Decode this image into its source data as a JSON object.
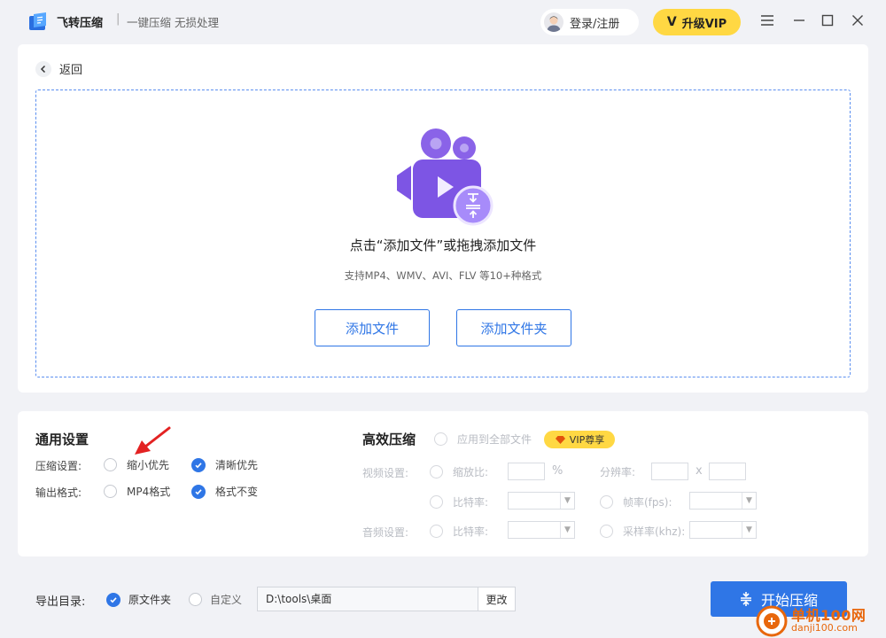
{
  "app": {
    "title": "飞转压缩",
    "separator": "|",
    "subtitle": "一键压缩 无损处理",
    "login_label": "登录/注册",
    "vip_mark": "V",
    "vip_label": "升级VIP"
  },
  "window_icons": [
    "menu-icon",
    "minimize-icon",
    "maximize-icon",
    "close-icon"
  ],
  "upload": {
    "back_label": "返回",
    "drop_title": "点击“添加文件”或拖拽添加文件",
    "drop_hint": "支持MP4、WMV、AVI、FLV 等10+种格式",
    "add_file_label": "添加文件",
    "add_folder_label": "添加文件夹"
  },
  "general": {
    "title": "通用设置",
    "compress_label": "压缩设置:",
    "compress_options": [
      {
        "label": "缩小优先",
        "checked": false
      },
      {
        "label": "清晰优先",
        "checked": true
      }
    ],
    "format_label": "输出格式:",
    "format_options": [
      {
        "label": "MP4格式",
        "checked": false
      },
      {
        "label": "格式不变",
        "checked": true
      }
    ]
  },
  "efficient": {
    "title": "高效压缩",
    "apply_all_label": "应用到全部文件",
    "vip_badge": "VIP尊享",
    "video_label": "视频设置:",
    "scale_label": "缩放比:",
    "percent_unit": "%",
    "resolution_label": "分辨率:",
    "resolution_x": "x",
    "bitrate_label": "比特率:",
    "fps_label": "帧率(fps):",
    "audio_label": "音频设置:",
    "audio_bitrate_label": "比特率:",
    "sample_rate_label": "采样率(khz):"
  },
  "output": {
    "label": "导出目录:",
    "original_label": "原文件夹",
    "original_checked": true,
    "custom_label": "自定义",
    "custom_checked": false,
    "path_value": "D:\\tools\\桌面",
    "change_label": "更改",
    "start_label": "开始压缩"
  },
  "watermark": {
    "name": "单机100网",
    "url": "danji100.com"
  },
  "colors": {
    "accent": "#2f76e6",
    "vip": "#ffd843",
    "dropzone_border": "#5b8ff0",
    "video_icon": "#8a63e8",
    "annotation_arrow": "#e32222"
  }
}
